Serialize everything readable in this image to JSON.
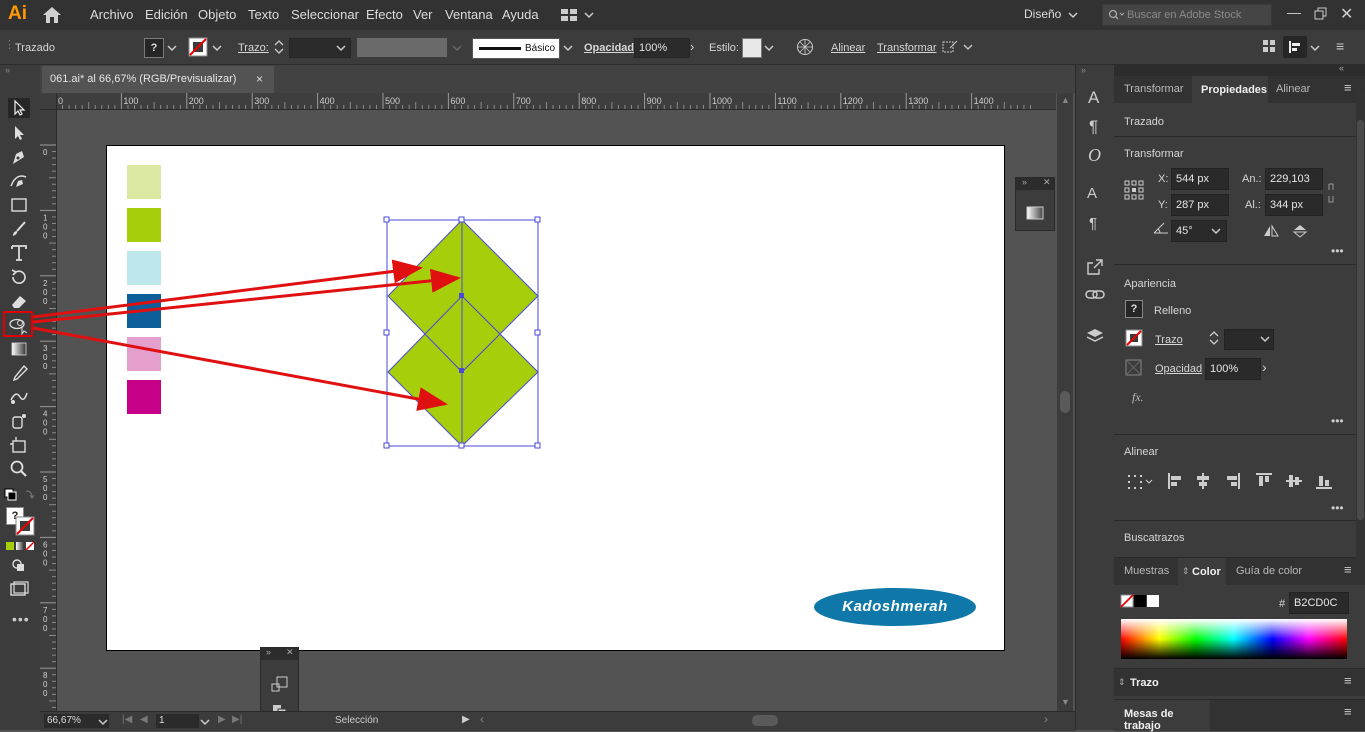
{
  "app": {
    "logo": "Ai"
  },
  "menu": [
    "Archivo",
    "Edición",
    "Objeto",
    "Texto",
    "Seleccionar",
    "Efecto",
    "Ver",
    "Ventana",
    "Ayuda"
  ],
  "workspace": "Diseño",
  "search": {
    "placeholder": "Buscar en Adobe Stock"
  },
  "control": {
    "selection_label": "Trazado",
    "stroke_label": "Trazo:",
    "brush_label": "Básico",
    "opacity_label": "Opacidad:",
    "opacity_value": "100%",
    "style_label": "Estilo:",
    "align_label": "Alinear",
    "transform_label": "Transformar"
  },
  "document_tab": {
    "title": "061.ai* al 66,67% (RGB/Previsualizar)",
    "close": "×"
  },
  "ruler_h": [
    "0",
    "100",
    "200",
    "300",
    "400",
    "500",
    "600",
    "700",
    "800",
    "900",
    "1000",
    "1100",
    "1200",
    "1300",
    "1400"
  ],
  "ruler_v": [
    "0",
    "1 0 0",
    "2 0 0",
    "3 0 0",
    "4 0 0",
    "5 0 0",
    "6 0 0",
    "7 0 0",
    "8 0 0"
  ],
  "swatches": {
    "colors": [
      "#dbe8a1",
      "#a6ce0a",
      "#bde7ec",
      "#0c5f9b",
      "#e49fcd",
      "#c7008a"
    ]
  },
  "diamond_fill": "#a6ce0a",
  "selection_color": "#4a4ad8",
  "arrow_color": "#e01010",
  "watermark": "Kadoshmerah",
  "watermark_color": "#1078a8",
  "panel_tabs": [
    "Transformar",
    "Propiedades",
    "Alinear"
  ],
  "properties": {
    "object_type": "Trazado",
    "transform_title": "Transformar",
    "x_label": "X:",
    "x_value": "544 px",
    "y_label": "Y:",
    "y_value": "287 px",
    "w_label": "An.:",
    "w_value": "229,103 px",
    "h_label": "Al.:",
    "h_value": "344 px",
    "angle_value": "45°",
    "appearance_title": "Apariencia",
    "fill_label": "Relleno",
    "stroke_label": "Trazo",
    "opacity_label": "Opacidad",
    "opacity_value": "100%",
    "fx_label": "fx.",
    "align_title": "Alinear",
    "pathfinder_title": "Buscatrazos"
  },
  "color_panel": {
    "tabs": [
      "Muestras",
      "Color",
      "Guía de color"
    ],
    "hash": "#",
    "hex": "B2CD0C"
  },
  "stroke_panel": "Trazo",
  "artboards_panel": "Mesas de trabajo",
  "status": {
    "zoom": "66,67%",
    "page": "1",
    "mode": "Selección"
  }
}
